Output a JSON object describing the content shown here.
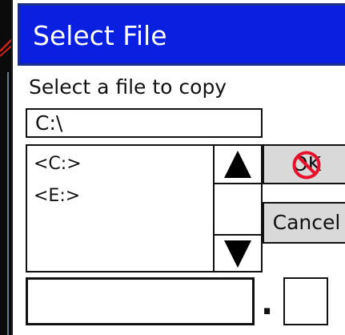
{
  "window": {
    "title": "Select File"
  },
  "dialog": {
    "prompt": "Select a file to copy",
    "path_value": "C:\\",
    "file_list": {
      "items": [
        "<C:>",
        "<E:>"
      ]
    },
    "buttons": {
      "ok_label": "OK",
      "cancel_label": "Cancel"
    },
    "filename": {
      "name_value": "",
      "separator": ".",
      "extension_value": ""
    }
  },
  "annotations": {
    "ok_disabled_mark": "no-symbol-icon"
  },
  "colors": {
    "titlebar": "#0a1fe0",
    "titlebar_border": "#1a2f88",
    "button_face": "#d9d9d9",
    "no_symbol": "#e8102a",
    "annotation_mark": "#d0201a"
  }
}
